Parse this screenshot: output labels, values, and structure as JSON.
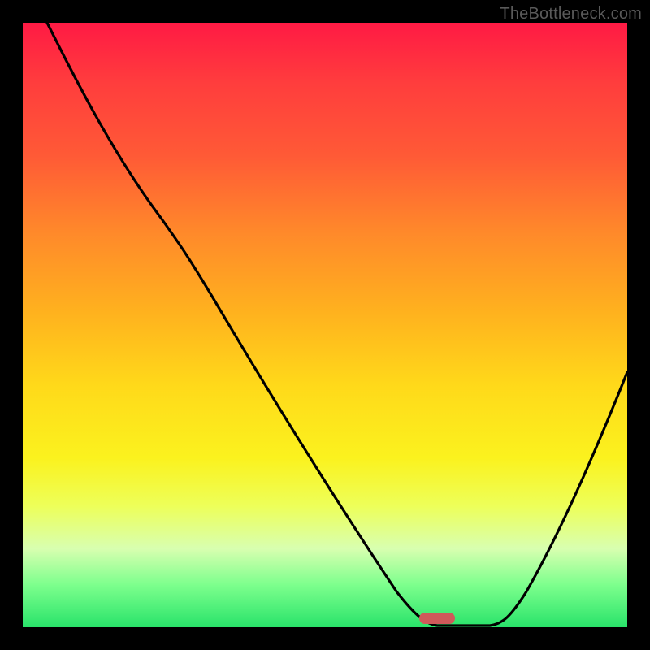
{
  "watermark": "TheBottleneck.com",
  "colors": {
    "frame": "#000000",
    "curve": "#000000",
    "marker": "#cf5a5a",
    "gradient_stops": [
      "#ff1a44",
      "#ff3d3d",
      "#ff5a36",
      "#ff8a2a",
      "#ffb21e",
      "#ffd91a",
      "#fbf21e",
      "#edff5a",
      "#d8ffb0",
      "#7dff8d",
      "#29e36a"
    ]
  },
  "chart_data": {
    "type": "line",
    "title": "",
    "xlabel": "",
    "ylabel": "",
    "xlim": [
      0,
      100
    ],
    "ylim": [
      0,
      100
    ],
    "grid": false,
    "legend": false,
    "note": "No axis ticks or numeric labels are rendered; values are estimated from pixel positions on a 0–100 scale (y=0 at bottom, y=100 at top).",
    "series": [
      {
        "name": "bottleneck-curve",
        "x": [
          4,
          12,
          20,
          25,
          30,
          40,
          50,
          60,
          65,
          68,
          72,
          78,
          84,
          90,
          96,
          100
        ],
        "y": [
          100,
          85,
          72,
          66,
          58,
          44,
          30,
          16,
          6,
          1,
          0,
          0,
          4,
          18,
          38,
          54
        ]
      }
    ],
    "marker": {
      "name": "highlight-region",
      "x_center": 69,
      "y": 0,
      "width_x_units": 6
    }
  }
}
